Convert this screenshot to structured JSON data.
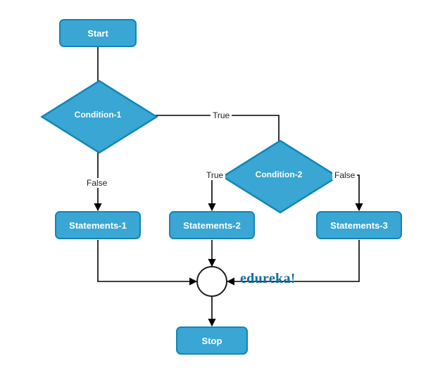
{
  "chart_data": {
    "type": "flowchart",
    "title": "",
    "nodes": [
      {
        "id": "start",
        "type": "terminator",
        "label": "Start"
      },
      {
        "id": "cond1",
        "type": "decision",
        "label": "Condition-1"
      },
      {
        "id": "cond2",
        "type": "decision",
        "label": "Condition-2"
      },
      {
        "id": "stmt1",
        "type": "process",
        "label": "Statements-1"
      },
      {
        "id": "stmt2",
        "type": "process",
        "label": "Statements-2"
      },
      {
        "id": "stmt3",
        "type": "process",
        "label": "Statements-3"
      },
      {
        "id": "merge",
        "type": "connector",
        "label": ""
      },
      {
        "id": "stop",
        "type": "terminator",
        "label": "Stop"
      }
    ],
    "edges": [
      {
        "from": "start",
        "to": "cond1",
        "label": ""
      },
      {
        "from": "cond1",
        "to": "cond2",
        "label": "True"
      },
      {
        "from": "cond1",
        "to": "stmt1",
        "label": "False"
      },
      {
        "from": "cond2",
        "to": "stmt2",
        "label": "True"
      },
      {
        "from": "cond2",
        "to": "stmt3",
        "label": "False"
      },
      {
        "from": "stmt1",
        "to": "merge",
        "label": ""
      },
      {
        "from": "stmt2",
        "to": "merge",
        "label": ""
      },
      {
        "from": "stmt3",
        "to": "merge",
        "label": ""
      },
      {
        "from": "merge",
        "to": "stop",
        "label": ""
      }
    ],
    "brand": "edureka!"
  },
  "labels": {
    "start": "Start",
    "cond1": "Condition-1",
    "cond2": "Condition-2",
    "stmt1": "Statements-1",
    "stmt2": "Statements-2",
    "stmt3": "Statements-3",
    "stop": "Stop",
    "true": "True",
    "false": "False",
    "brand": "edureka!"
  }
}
